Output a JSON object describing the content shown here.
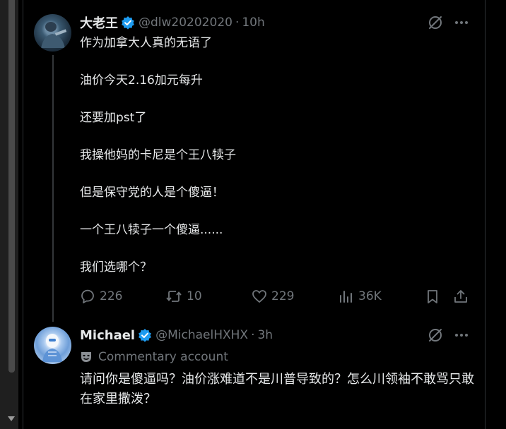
{
  "tweet": {
    "author_name": "大老王",
    "handle": "@dlw20202020",
    "separator": "·",
    "time": "10h",
    "lines": [
      "作为加拿大人真的无语了",
      "油价今天2.16加元每升",
      "还要加pst了",
      "我操他妈的卡尼是个王八犊子",
      "但是保守党的人是个傻逼！",
      "一个王八犊子一个傻逼......",
      "我们选哪个？"
    ],
    "stats": {
      "replies": "226",
      "reposts": "10",
      "likes": "229",
      "views": "36K"
    }
  },
  "reply": {
    "author_name": "Michael",
    "handle": "@MichaelHXHX",
    "separator": "·",
    "time": "3h",
    "commentary_label": "Commentary account",
    "text": "请问你是傻逼吗？油价涨难道不是川普导致的？怎么川领袖不敢骂只敢在家里撒泼？"
  },
  "colors": {
    "background": "#000000",
    "text": "#e7e9ea",
    "muted": "#71767b",
    "verified": "#1d9bf0"
  }
}
